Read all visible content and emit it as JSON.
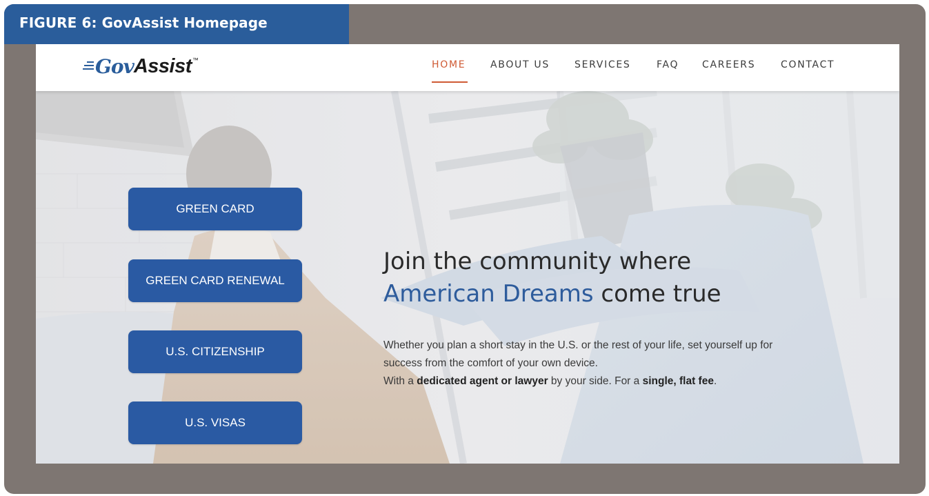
{
  "figure_caption": "FIGURE 6: GovAssist Homepage",
  "logo": {
    "part1": "Gov",
    "part2": "Assist",
    "tm": "™"
  },
  "nav": {
    "items": [
      "HOME",
      "ABOUT US",
      "SERVICES",
      "FAQ",
      "CAREERS",
      "CONTACT"
    ],
    "active": "HOME"
  },
  "services": [
    "GREEN CARD",
    "GREEN CARD RENEWAL",
    "U.S. CITIZENSHIP",
    "U.S. VISAS"
  ],
  "headline": {
    "line1": "Join the community where",
    "line2_highlight": "American Dreams",
    "line2_rest": " come true"
  },
  "body": {
    "line1": "Whether you plan a short stay in the U.S. or the rest of your life, set yourself up for",
    "line2": "success from the comfort of your own device.",
    "line3_a": "With a ",
    "line3_b": "dedicated agent or lawyer",
    "line3_c": " by your side. For a ",
    "line3_d": "single, flat fee",
    "line3_e": "."
  },
  "colors": {
    "frame": "#7e7672",
    "caption_bg": "#2a5d9b",
    "accent": "#cf5a34",
    "button": "#2a5aa3",
    "headline_blue": "#2e5c9c"
  },
  "icons": [
    "govassist-logo"
  ]
}
